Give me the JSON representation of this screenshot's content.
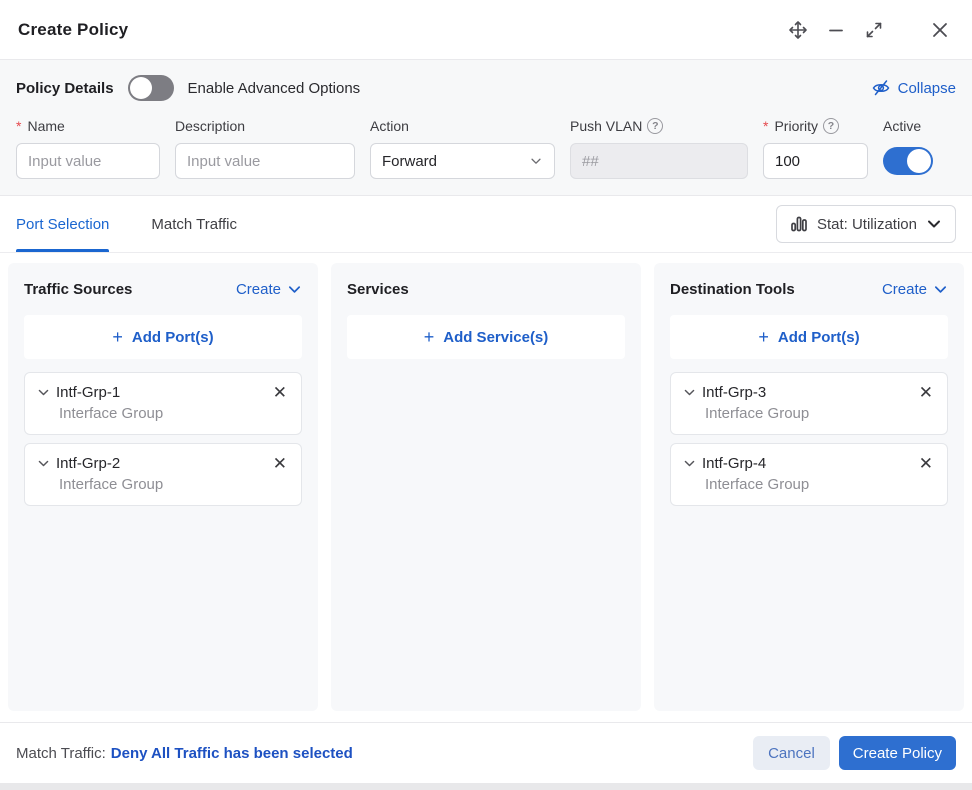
{
  "window": {
    "title": "Create Policy"
  },
  "policy_details": {
    "section_label": "Policy Details",
    "advanced_toggle_label": "Enable Advanced Options",
    "advanced_toggle_state": "off",
    "collapse_label": "Collapse",
    "fields": {
      "name": {
        "label": "Name",
        "required": true,
        "placeholder": "Input value",
        "value": ""
      },
      "description": {
        "label": "Description",
        "placeholder": "Input value",
        "value": ""
      },
      "action": {
        "label": "Action",
        "value": "Forward"
      },
      "push_vlan": {
        "label": "Push VLAN",
        "placeholder": "##",
        "disabled": true
      },
      "priority": {
        "label": "Priority",
        "required": true,
        "value": "100"
      },
      "active": {
        "label": "Active",
        "state": "on"
      }
    }
  },
  "tabs": [
    {
      "label": "Port Selection",
      "active": true
    },
    {
      "label": "Match Traffic",
      "active": false
    }
  ],
  "stat_dropdown": {
    "label": "Stat: Utilization"
  },
  "panels": {
    "traffic_sources": {
      "title": "Traffic Sources",
      "create_label": "Create",
      "add_label": "Add Port(s)",
      "items": [
        {
          "name": "Intf-Grp-1",
          "type": "Interface Group"
        },
        {
          "name": "Intf-Grp-2",
          "type": "Interface Group"
        }
      ]
    },
    "services": {
      "title": "Services",
      "add_label": "Add Service(s)",
      "items": []
    },
    "destination_tools": {
      "title": "Destination Tools",
      "create_label": "Create",
      "add_label": "Add Port(s)",
      "items": [
        {
          "name": "Intf-Grp-3",
          "type": "Interface Group"
        },
        {
          "name": "Intf-Grp-4",
          "type": "Interface Group"
        }
      ]
    }
  },
  "footer": {
    "match_traffic_prefix": "Match Traffic:",
    "match_traffic_message": "Deny All Traffic has been selected",
    "cancel_label": "Cancel",
    "submit_label": "Create Policy"
  },
  "symbols": {
    "plus": "+",
    "close": "✕"
  },
  "colors": {
    "accent_blue": "#2e6fd0",
    "link_blue": "#1f5fc9",
    "required_red": "#e5484d",
    "section_bg": "#f7f8f9",
    "panel_bg": "#f7f8fa"
  }
}
